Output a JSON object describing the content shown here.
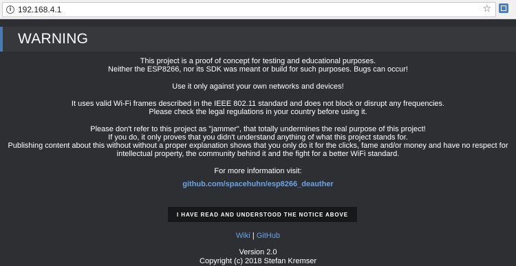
{
  "browser": {
    "url": "192.168.4.1",
    "info_icon_glyph": "i",
    "star_icon_glyph": "☆",
    "icons": [
      "info-icon",
      "star-icon",
      "extension-icon"
    ]
  },
  "warning": {
    "title": "WARNING",
    "accent_color": "#4b7bb1"
  },
  "notice": {
    "paragraph1": [
      "This project is a proof of concept for testing and educational purposes.",
      "Neither the ESP8266, nor its SDK was meant or build for such purposes. Bugs can occur!"
    ],
    "paragraph2": [
      "Use it only against your own networks and devices!"
    ],
    "paragraph3": [
      "It uses valid Wi-Fi frames described in the IEEE 802.11 standard and does not block or disrupt any frequencies.",
      "Please check the legal regulations in your country before using it."
    ],
    "paragraph4": [
      "Please don't refer to this project as \"jammer\", that totally undermines the real purpose of this project!",
      "If you do, it only proves that you didn't understand anything of what this project stands for.",
      "Publishing content about this without without a proper explanation shows that you only do it for the clicks, fame and/or money and have no respect for",
      "intellectual property, the community behind it and the fight for a better WiFi standard."
    ],
    "more_info_label": "For more information visit:",
    "repo_link": "github.com/spacehuhn/esp8266_deauther"
  },
  "ack_button_label": "I HAVE READ AND UNDERSTOOD THE NOTICE ABOVE",
  "footer": {
    "wiki_link": "Wiki",
    "separator": "|",
    "github_link": "GitHub",
    "version": "Version 2.0",
    "copyright": "Copyright (c) 2018 Stefan Kremser"
  },
  "colors": {
    "background": "#2e2f32",
    "header_bg": "#36383c",
    "link": "#6aa3e6",
    "button_bg": "#17181a"
  }
}
